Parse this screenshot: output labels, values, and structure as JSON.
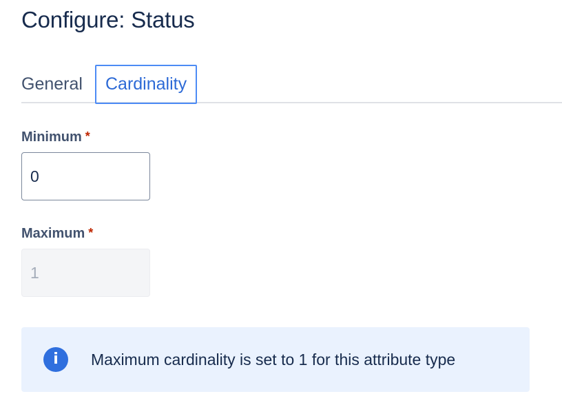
{
  "page": {
    "title": "Configure: Status"
  },
  "tabs": [
    {
      "label": "General",
      "selected": false
    },
    {
      "label": "Cardinality",
      "selected": true
    }
  ],
  "form": {
    "minimum": {
      "label": "Minimum",
      "required_mark": "*",
      "value": "0",
      "disabled": false
    },
    "maximum": {
      "label": "Maximum",
      "required_mark": "*",
      "value": "1",
      "disabled": true
    }
  },
  "info_message": {
    "icon": "info-icon",
    "icon_glyph": "i",
    "text": "Maximum cardinality is set to 1 for this attribute type",
    "background_color": "#eaf2fe",
    "icon_color": "#2f6fde"
  },
  "colors": {
    "accent": "#2d6ad6",
    "required": "#bf2600"
  }
}
